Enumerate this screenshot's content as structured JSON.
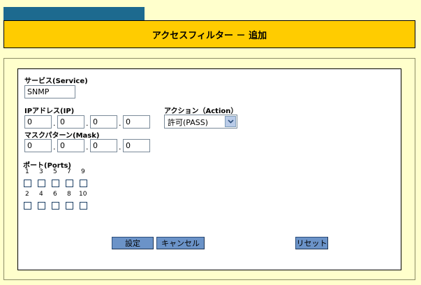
{
  "page": {
    "title": "アクセスフィルター － 追加"
  },
  "form": {
    "service": {
      "label": "サービス(Service)",
      "value": "SNMP"
    },
    "ip": {
      "label": "IPアドレス(IP)",
      "octets": [
        "0",
        "0",
        "0",
        "0"
      ]
    },
    "mask": {
      "label": "マスクパターン(Mask)",
      "octets": [
        "0",
        "0",
        "0",
        "0"
      ]
    },
    "action": {
      "label": "アクション（Action）",
      "selected": "許可(PASS)"
    },
    "ports": {
      "label": "ポート(Ports)",
      "row1": [
        "1",
        "3",
        "5",
        "7",
        "9"
      ],
      "row2": [
        "2",
        "4",
        "6",
        "8",
        "10"
      ]
    },
    "dot": "."
  },
  "buttons": {
    "set": "設定",
    "cancel": "キャンセル",
    "reset": "リセット"
  },
  "colors": {
    "background": "#ffffcc",
    "header_tab": "#1d6a8f",
    "title_bar": "#ffcc00",
    "button": "#6b93c8"
  }
}
